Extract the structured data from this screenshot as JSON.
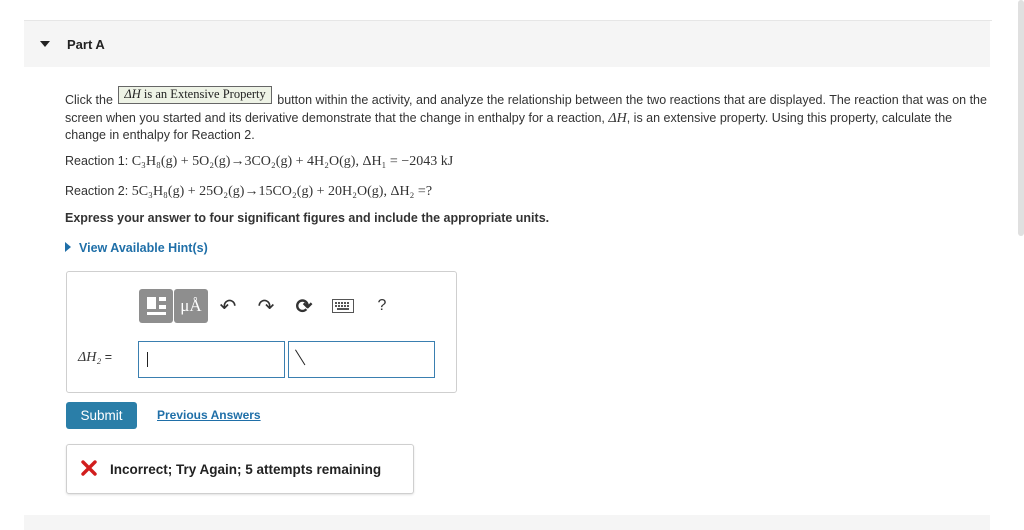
{
  "part": {
    "title": "Part A"
  },
  "problem": {
    "text_before_button": "Click the",
    "button": {
      "symbol": "ΔH",
      "label": "is an Extensive Property"
    },
    "text_after_button_1": "button within the activity, and analyze the relationship between the two reactions that are displayed. The reaction that was on the screen when you started and its derivative demonstrate that the change in enthalpy for a reaction,",
    "symbol_dH": "ΔH",
    "text_after_button_2": ", is an extensive property. Using this property, calculate the change in enthalpy for Reaction 2.",
    "reaction1": {
      "label": "Reaction 1:",
      "equation": "C₃H₈(g) + 5O₂(g)→3CO₂(g) + 4H₂O(g), ΔH₁ = −2043 kJ"
    },
    "reaction2": {
      "label": "Reaction 2:",
      "equation": "5C₃H₈(g) + 25O₂(g)→15CO₂(g) + 20H₂O(g), ΔH₂ =?"
    },
    "instructions": "Express your answer to four significant figures and include the appropriate units.",
    "hints_link": "View Available Hint(s)"
  },
  "answer": {
    "toolbar": {
      "units_label": "μÅ",
      "undo_icon": "↶",
      "redo_icon": "↷",
      "reset_icon": "⟳",
      "help_label": "?"
    },
    "variable_label": "ΔH₂",
    "equals": "=",
    "value": "",
    "units": ""
  },
  "actions": {
    "submit": "Submit",
    "previous_answers": "Previous Answers"
  },
  "feedback": {
    "message": "Incorrect; Try Again; 5 attempts remaining",
    "color": "#d11d1d"
  },
  "colors": {
    "accent": "#2a7ea8",
    "link": "#1f6fa8"
  }
}
